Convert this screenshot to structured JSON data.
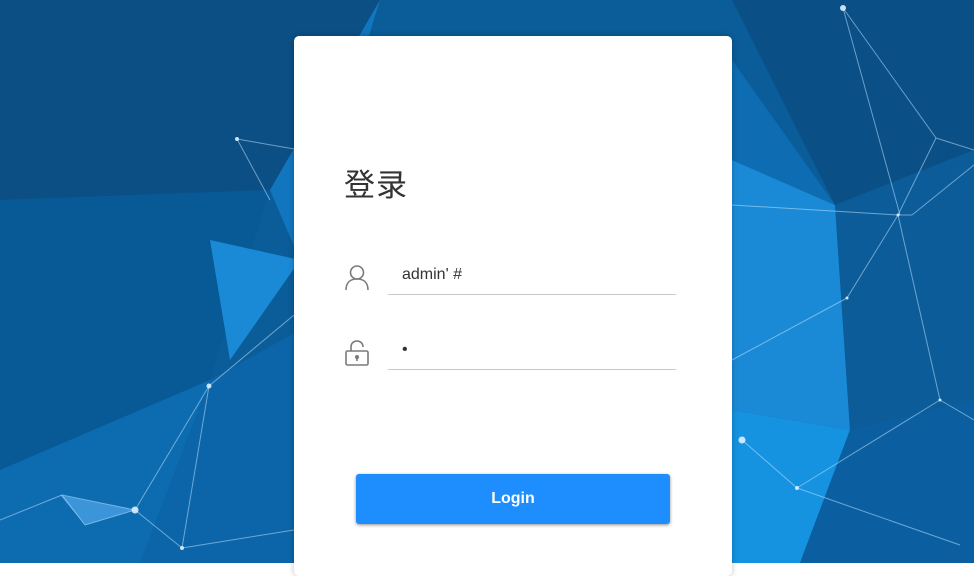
{
  "login": {
    "title": "登录",
    "username": {
      "value": "admin' #",
      "icon": "user-icon"
    },
    "password": {
      "value": "•",
      "icon": "unlock-icon"
    },
    "submit_label": "Login"
  },
  "colors": {
    "background": "#0a5d99",
    "button": "#1e8eff",
    "card": "#ffffff"
  }
}
